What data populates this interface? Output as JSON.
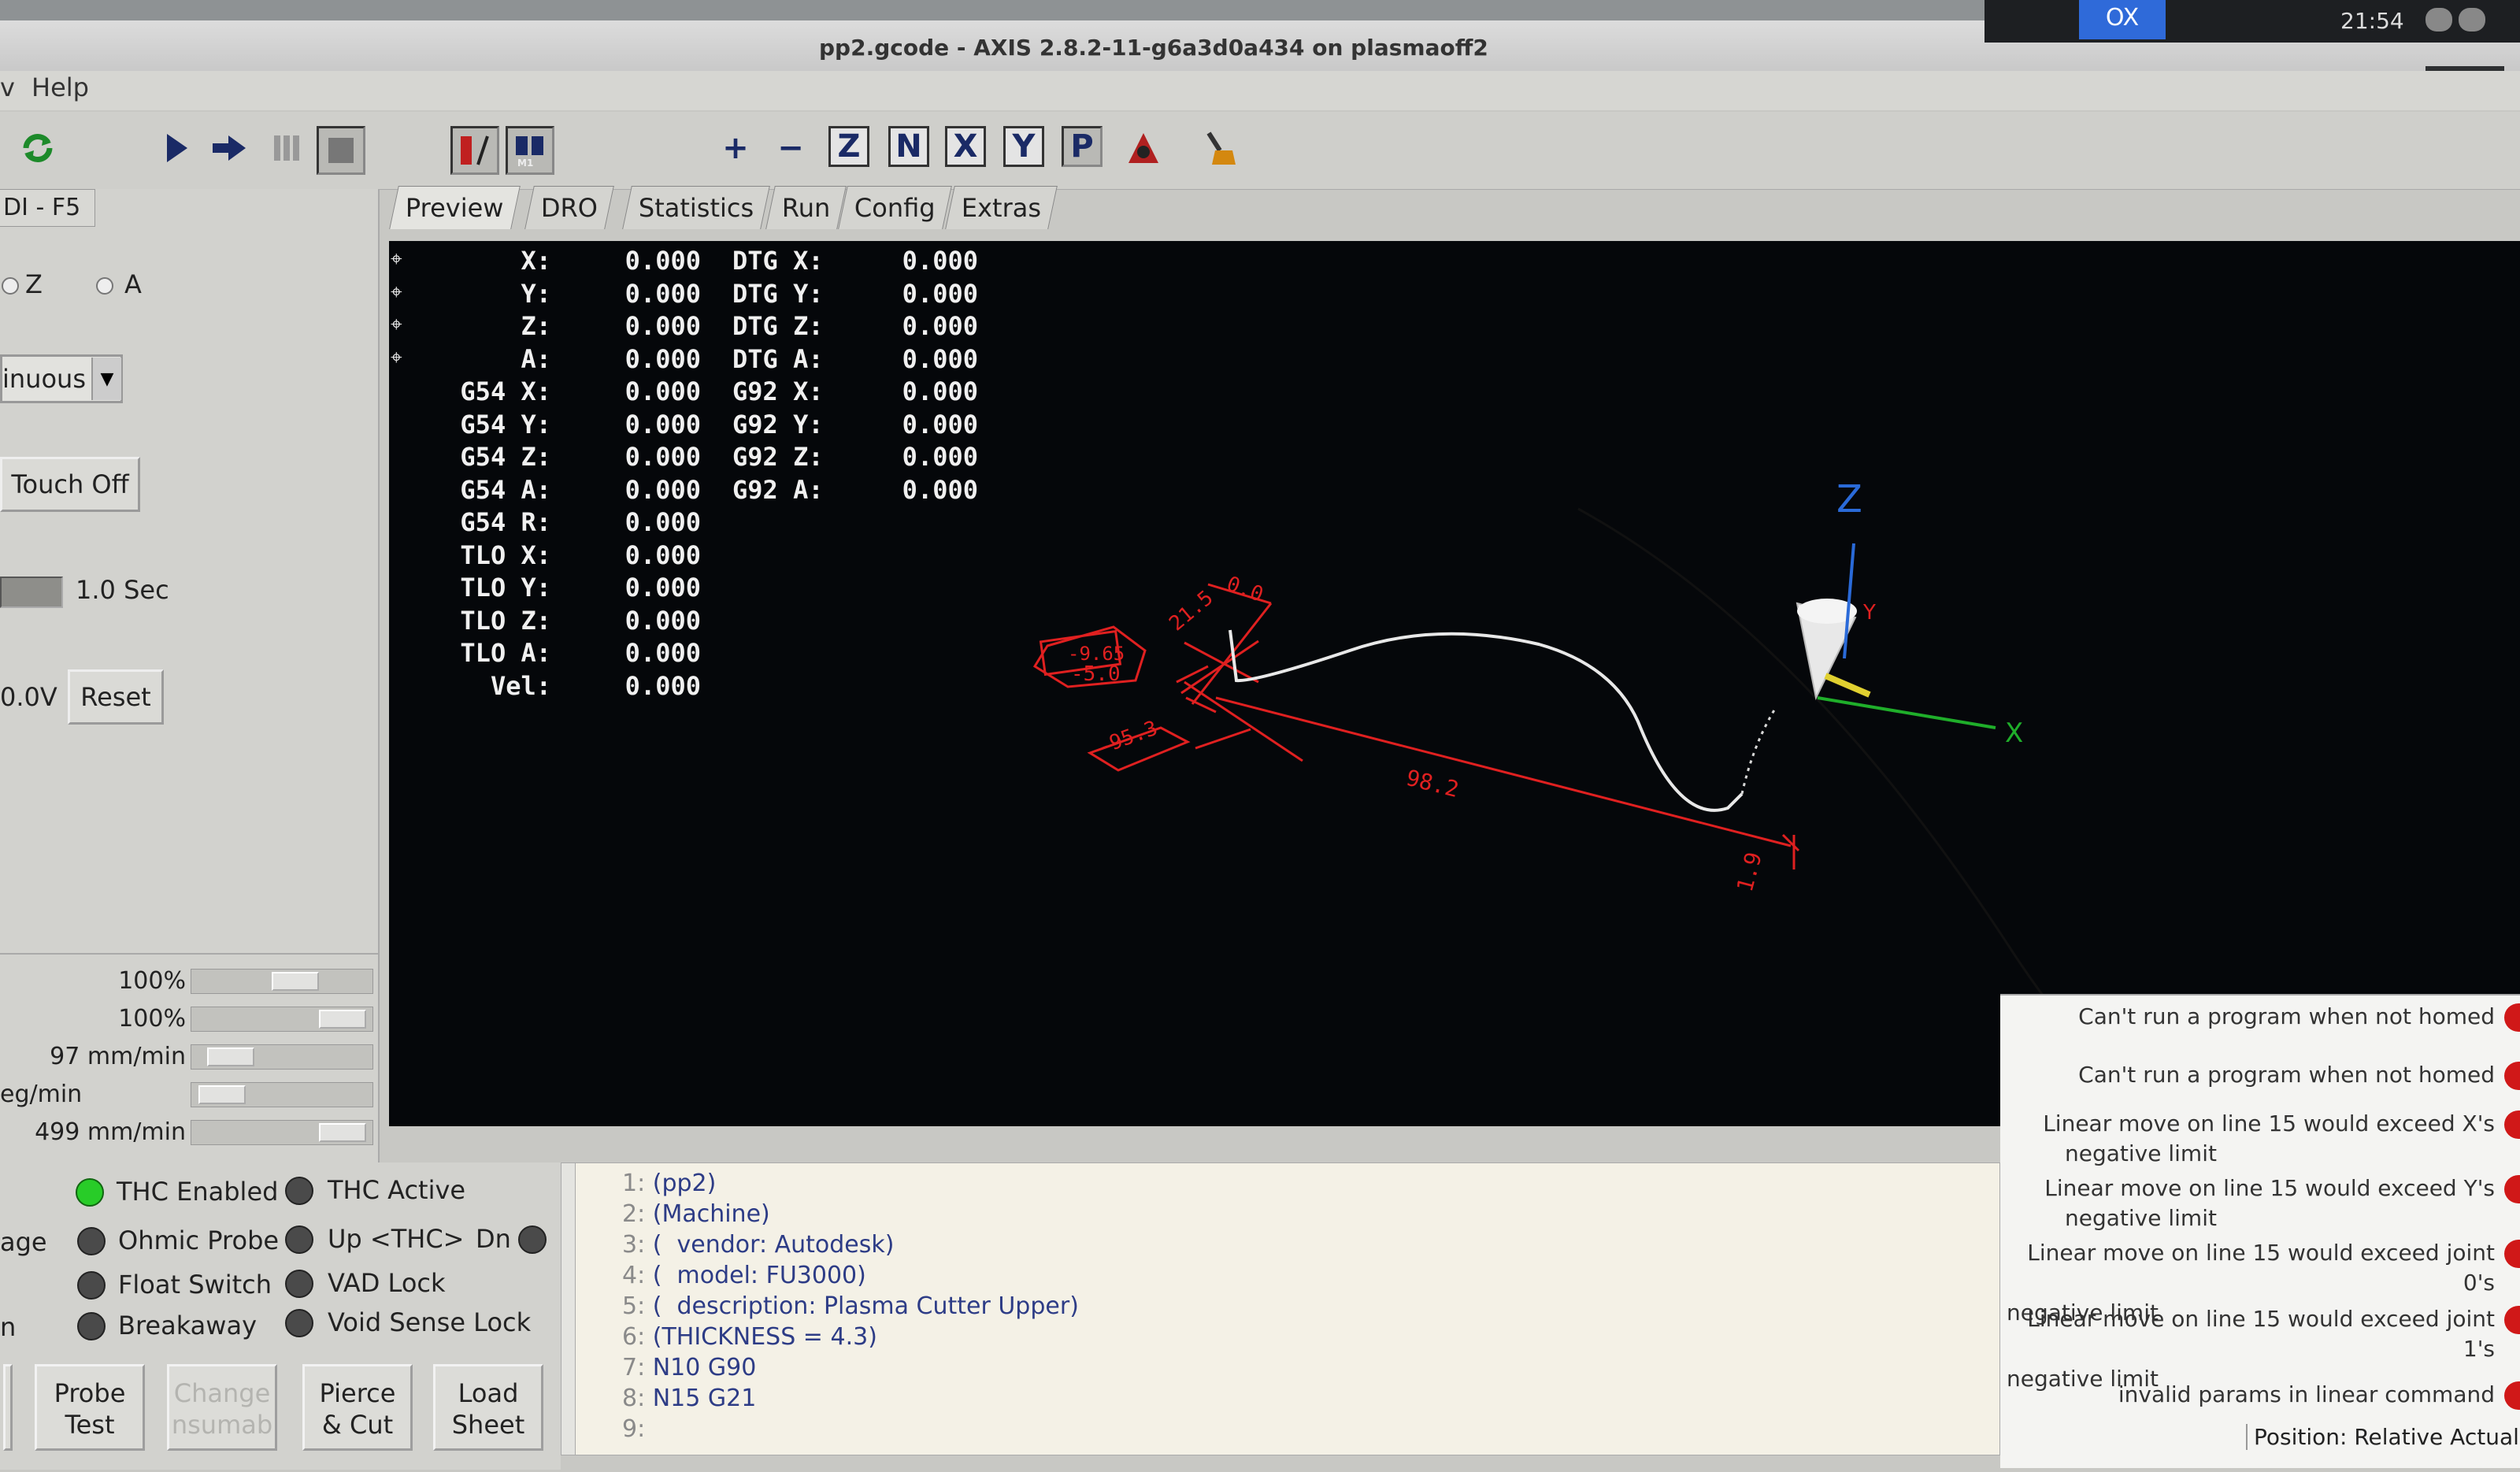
{
  "window": {
    "title": "pp2.gcode - AXIS 2.8.2-11-g6a3d0a434 on plasmaoff2",
    "clock": "21:54",
    "tray_active": "OX",
    "wm_buttons": "↑  –"
  },
  "menubar": {
    "partial": "v",
    "help": "Help"
  },
  "toolbar": {
    "icons": [
      "reload-icon",
      "run-icon",
      "step-icon",
      "pause-icon",
      "stop-icon",
      "toggle-skip-icon",
      "optional-stop-icon",
      "zoom-in-icon",
      "zoom-out-icon",
      "view-z-icon",
      "view-z2-icon",
      "view-x-icon",
      "view-y-icon",
      "view-p-icon",
      "rotate-icon",
      "clear-plot-icon"
    ],
    "letters": {
      "z": "Z",
      "z2": "N",
      "x": "X",
      "y": "Y",
      "p": "P",
      "plus": "+",
      "minus": "−"
    }
  },
  "left_panel": {
    "tab_label": "DI - F5",
    "axis_z": "Z",
    "axis_a": "A",
    "jog_mode": "inuous",
    "touch_off": "Touch Off",
    "probe_time": "1.0 Sec",
    "voltage": "0.0V",
    "reset": "Reset",
    "overrides": [
      {
        "label": "100%",
        "fraction": 0.6
      },
      {
        "label": "100%",
        "fraction": 0.95
      },
      {
        "label": "97 mm/min",
        "fraction": 0.12
      },
      {
        "label": "eg/min",
        "fraction": 0.05
      },
      {
        "label": "499 mm/min",
        "fraction": 0.95
      }
    ]
  },
  "tabs": [
    "Preview",
    "DRO",
    "Statistics",
    "Run",
    "Config",
    "Extras"
  ],
  "dro": {
    "rows": [
      {
        "label": "X:",
        "value": "0.000",
        "label2": "DTG X:",
        "value2": "0.000"
      },
      {
        "label": "Y:",
        "value": "0.000",
        "label2": "DTG Y:",
        "value2": "0.000"
      },
      {
        "label": "Z:",
        "value": "0.000",
        "label2": "DTG Z:",
        "value2": "0.000"
      },
      {
        "label": "A:",
        "value": "0.000",
        "label2": "DTG A:",
        "value2": "0.000"
      },
      {
        "label": "G54 X:",
        "value": "0.000",
        "label2": "G92 X:",
        "value2": "0.000"
      },
      {
        "label": "G54 Y:",
        "value": "0.000",
        "label2": "G92 Y:",
        "value2": "0.000"
      },
      {
        "label": "G54 Z:",
        "value": "0.000",
        "label2": "G92 Z:",
        "value2": "0.000"
      },
      {
        "label": "G54 A:",
        "value": "0.000",
        "label2": "G92 A:",
        "value2": "0.000"
      },
      {
        "label": "G54 R:",
        "value": "0.000",
        "label2": "",
        "value2": ""
      },
      {
        "label": "TLO X:",
        "value": "0.000",
        "label2": "",
        "value2": ""
      },
      {
        "label": "TLO Y:",
        "value": "0.000",
        "label2": "",
        "value2": ""
      },
      {
        "label": "TLO Z:",
        "value": "0.000",
        "label2": "",
        "value2": ""
      },
      {
        "label": "TLO A:",
        "value": "0.000",
        "label2": "",
        "value2": ""
      },
      {
        "label": "Vel:",
        "value": "0.000",
        "label2": "",
        "value2": ""
      }
    ]
  },
  "preview_labels": {
    "dim_top": "0.0",
    "dim_215": "21.5",
    "dim_box1": "-9.65",
    "dim_box2": "-5.0",
    "dim_box3": "-95.3",
    "dim_982": "98.2",
    "dim_19": "1.9",
    "axis_z": "Z",
    "axis_x": "X",
    "axis_y": "Y"
  },
  "thc": {
    "thc_enabled": "THC Enabled",
    "thc_active": "THC Active",
    "age": "age",
    "ohmic_probe": "Ohmic Probe",
    "up_thc": "Up <THC>",
    "dn": "Dn",
    "float_switch": "Float Switch",
    "vad_lock": "VAD Lock",
    "n": "n",
    "breakaway": "Breakaway",
    "void_sense": "Void Sense Lock"
  },
  "buttons": {
    "probe_test_1": "Probe",
    "probe_test_2": "Test",
    "change_1": "Change",
    "change_2": "nsumab",
    "pierce_1": "Pierce",
    "pierce_2": "& Cut",
    "load_1": "Load",
    "load_2": "Sheet"
  },
  "gcode": [
    {
      "num": "1:",
      "text": "(pp2)"
    },
    {
      "num": "2:",
      "text": "(Machine)"
    },
    {
      "num": "3:",
      "text": "(  vendor: Autodesk)"
    },
    {
      "num": "4:",
      "text": "(  model: FU3000)"
    },
    {
      "num": "5:",
      "text": "(  description: Plasma Cutter Upper)"
    },
    {
      "num": "6:",
      "text": "(THICKNESS = 4.3)"
    },
    {
      "num": "7:",
      "text": "N10 G90"
    },
    {
      "num": "8:",
      "text": "N15 G21"
    },
    {
      "num": "9:",
      "text": ""
    }
  ],
  "messages": [
    "Can't run a program when not homed",
    "Can't run a program when not homed",
    "Linear move on line 15 would exceed X's\nnegative limit",
    "Linear move on line 15 would exceed Y's\nnegative limit",
    "Linear move on line 15 would exceed joint 0's\nnegative limit",
    "Linear move on line 15 would exceed joint 1's\nnegative limit",
    "invalid params in linear command"
  ],
  "status": "Position: Relative Actual",
  "colors": {
    "thc_on": "#28cc28",
    "dim_red": "#e02020",
    "path_white": "#e8e8e8",
    "msg_red": "#d01818"
  }
}
